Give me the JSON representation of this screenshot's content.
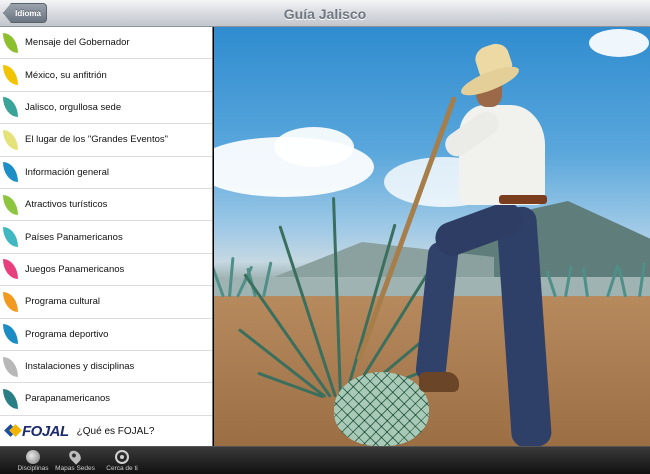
{
  "navbar": {
    "back_label": "Idioma",
    "title": "Guía Jalisco"
  },
  "sidebar": {
    "items": [
      {
        "label": "Mensaje del Gobernador",
        "color": "#8dbf2e"
      },
      {
        "label": "México, su anfitrión",
        "color": "#f2c400"
      },
      {
        "label": "Jalisco, orgullosa sede",
        "color": "#3aa39a"
      },
      {
        "label": "El lugar de los \"Grandes Eventos\"",
        "color": "#e6e27a"
      },
      {
        "label": "Información general",
        "color": "#1e8fc6"
      },
      {
        "label": "Atractivos turísticos",
        "color": "#8cc63f"
      },
      {
        "label": "Países Panamericanos",
        "color": "#3fb8c2"
      },
      {
        "label": "Juegos Panamericanos",
        "color": "#e8407e"
      },
      {
        "label": "Programa cultural",
        "color": "#f29a1f"
      },
      {
        "label": "Programa deportivo",
        "color": "#1c8cc4"
      },
      {
        "label": "Instalaciones y disciplinas",
        "color": "#b8b8b8"
      },
      {
        "label": "Parapanamericanos",
        "color": "#2a7f86"
      }
    ],
    "fojal": {
      "logo_text": "FOJAL",
      "label": "¿Qué es FOJAL?"
    }
  },
  "tabbar": {
    "tabs": [
      {
        "label": "Disciplinas",
        "icon": "disc-icon"
      },
      {
        "label": "Mapas Sedes",
        "icon": "map-pin-icon"
      },
      {
        "label": "Cerca de ti",
        "icon": "target-icon"
      }
    ]
  }
}
